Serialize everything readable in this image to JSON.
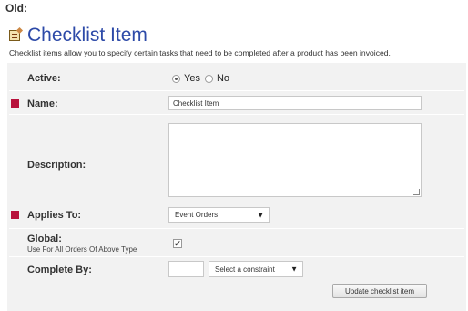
{
  "heading": "Old:",
  "header": {
    "title": "Checklist Item",
    "icon": "checklist-icon",
    "subtitle": "Checklist items allow you to specify certain tasks that need to be completed after a product has been invoiced."
  },
  "form": {
    "active": {
      "label": "Active:",
      "yes_label": "Yes",
      "no_label": "No",
      "selected": "Yes"
    },
    "name": {
      "label": "Name:",
      "value": "Checklist Item",
      "required": true
    },
    "description": {
      "label": "Description:",
      "value": ""
    },
    "applies_to": {
      "label": "Applies To:",
      "value": "Event Orders",
      "required": true
    },
    "global": {
      "label": "Global:",
      "sublabel": "Use For All Orders Of Above Type",
      "checked": true
    },
    "complete_by": {
      "label": "Complete By:",
      "value": "",
      "constraint_placeholder": "Select a constraint"
    },
    "submit_label": "Update checklist item"
  },
  "colors": {
    "title": "#2d4aa8",
    "required_marker": "#b8123c",
    "panel_bg": "#f2f2f2"
  }
}
